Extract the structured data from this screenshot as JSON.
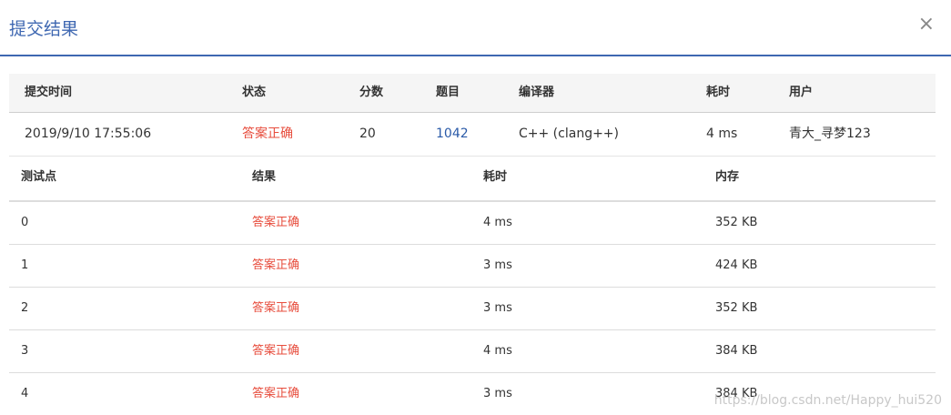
{
  "dialog": {
    "title": "提交结果",
    "close": "×"
  },
  "summary": {
    "headers": [
      "提交时间",
      "状态",
      "分数",
      "题目",
      "编译器",
      "耗时",
      "用户"
    ],
    "row": {
      "time": "2019/9/10 17:55:06",
      "status": "答案正确",
      "score": "20",
      "problem": "1042",
      "compiler": "C++ (clang++)",
      "elapsed": "4 ms",
      "user": "青大_寻梦123"
    }
  },
  "cases": {
    "headers": [
      "测试点",
      "结果",
      "耗时",
      "内存"
    ],
    "rows": [
      {
        "id": "0",
        "result": "答案正确",
        "time": "4 ms",
        "memory": "352 KB"
      },
      {
        "id": "1",
        "result": "答案正确",
        "time": "3 ms",
        "memory": "424 KB"
      },
      {
        "id": "2",
        "result": "答案正确",
        "time": "3 ms",
        "memory": "352 KB"
      },
      {
        "id": "3",
        "result": "答案正确",
        "time": "4 ms",
        "memory": "384 KB"
      },
      {
        "id": "4",
        "result": "答案正确",
        "time": "3 ms",
        "memory": "384 KB"
      }
    ]
  },
  "watermark": "https://blog.csdn.net/Happy_hui520",
  "colors": {
    "accent": "#3e67b1",
    "success": "#e74c3c",
    "link": "#2a5aa8"
  }
}
